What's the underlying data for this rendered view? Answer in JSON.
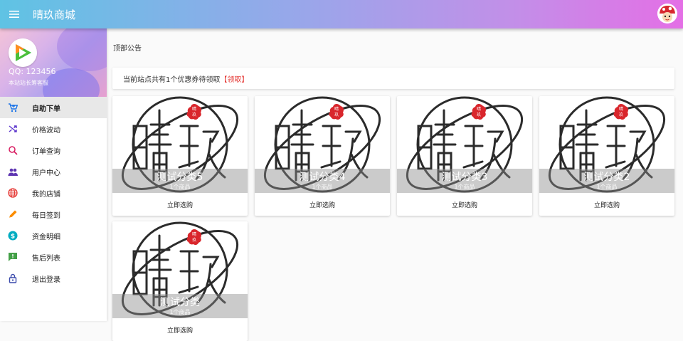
{
  "app": {
    "title": "晴玖商城"
  },
  "profile": {
    "qq": "QQ: 123456",
    "subtitle": "本站站长筹客服"
  },
  "nav": [
    {
      "label": "自助下单",
      "icon": "cart-icon",
      "color": "#1a73e8",
      "active": true
    },
    {
      "label": "价格波动",
      "icon": "shuffle-icon",
      "color": "#5c35cc",
      "active": false
    },
    {
      "label": "订单查询",
      "icon": "search-icon",
      "color": "#d81b60",
      "active": false
    },
    {
      "label": "用户中心",
      "icon": "people-icon",
      "color": "#5e35b1",
      "active": false
    },
    {
      "label": "我的店铺",
      "icon": "globe-icon",
      "color": "#e53935",
      "active": false
    },
    {
      "label": "每日签到",
      "icon": "pencil-icon",
      "color": "#fb8c00",
      "active": false
    },
    {
      "label": "资金明细",
      "icon": "dollar-icon",
      "color": "#00acc1",
      "active": false
    },
    {
      "label": "售后列表",
      "icon": "feedback-icon",
      "color": "#43a047",
      "active": false
    },
    {
      "label": "退出登录",
      "icon": "lock-icon",
      "color": "#3949ab",
      "active": false
    }
  ],
  "main": {
    "notice": "顶部公告",
    "coupon_text": "当前站点共有1个优惠券待领取",
    "coupon_link": "【领取】"
  },
  "categories": [
    {
      "name": "测试分类5",
      "count": "1个商品",
      "action": "立即选购"
    },
    {
      "name": "测试分类4",
      "count": "1个商品",
      "action": "立即选购"
    },
    {
      "name": "测试分类3",
      "count": "1个商品",
      "action": "立即选购"
    },
    {
      "name": "测试分类2",
      "count": "1个商品",
      "action": "立即选购"
    },
    {
      "name": "测试分类",
      "count": "1个商品",
      "action": "立即选购"
    }
  ],
  "logo": {
    "stamp_text": "晴玖"
  }
}
